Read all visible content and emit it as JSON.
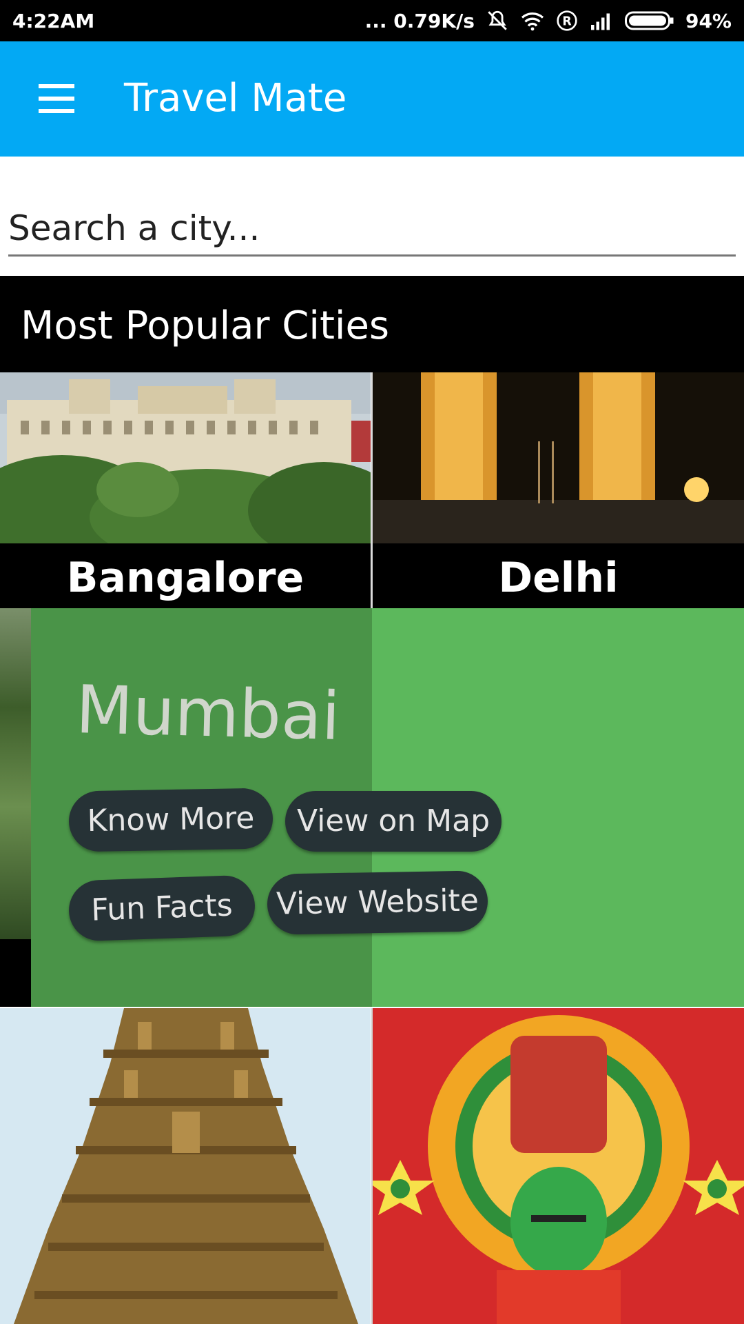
{
  "status_bar": {
    "time": "4:22AM",
    "network_speed": "... 0.79K/s",
    "battery": "94%",
    "icons": [
      "mute-icon",
      "wifi-icon",
      "roaming-icon",
      "signal-icon",
      "battery-icon"
    ]
  },
  "app_bar": {
    "title": "Travel Mate",
    "menu_icon": "hamburger-menu-icon",
    "color": "#03A9F4"
  },
  "search": {
    "placeholder": "Search a city..."
  },
  "section": {
    "title": "Most Popular Cities"
  },
  "cities": [
    {
      "name": "Bangalore"
    },
    {
      "name": "Delhi"
    }
  ],
  "expanded_city": {
    "name": "Mumbai",
    "actions": [
      "Know More",
      "View on Map",
      "Fun Facts",
      "View Website"
    ],
    "card_color": "#5cb85c"
  }
}
